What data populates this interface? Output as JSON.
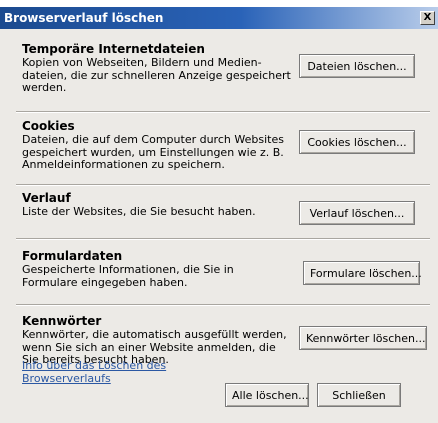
{
  "window": {
    "title": "Browserverlauf löschen",
    "close_label": "X"
  },
  "sections": [
    {
      "title": "Temporäre Internetdateien",
      "description": "Kopien von Webseiten, Bildern und Medien-dateien, die zur schnelleren Anzeige gespeichert werden.",
      "button": "Dateien löschen..."
    },
    {
      "title": "Cookies",
      "description": "Dateien, die auf dem Computer durch Websites gespeichert wurden, um Einstellungen wie z. B. Anmeldeinformationen zu speichern.",
      "button": "Cookies löschen..."
    },
    {
      "title": "Verlauf",
      "description": "Liste der Websites, die Sie besucht haben.",
      "button": "Verlauf löschen..."
    },
    {
      "title": "Formulardaten",
      "description": "Gespeicherte Informationen, die Sie in Formulare eingegeben haben.",
      "button": "Formulare löschen..."
    },
    {
      "title": "Kennwörter",
      "description": "Kennwörter, die automatisch ausgefüllt werden, wenn Sie sich an einer Website anmelden, die Sie bereits besucht haben.",
      "button": "Kennwörter löschen..."
    }
  ],
  "footer": {
    "info_link": "Info über das Löschen des Browserverlaufs",
    "delete_all": "Alle löschen...",
    "close": "Schließen"
  },
  "colors": {
    "title_bar": "#2a63b8",
    "dialog_bg": "#eceae6",
    "link": "#2b58a3"
  }
}
